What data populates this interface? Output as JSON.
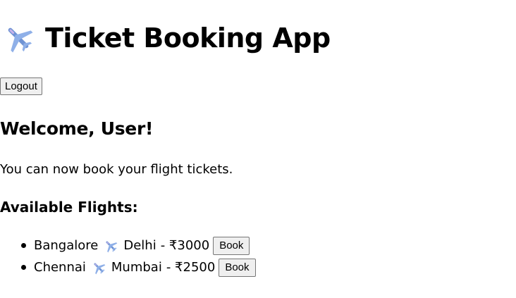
{
  "header": {
    "icon": "airplane-icon",
    "title": "Ticket Booking App"
  },
  "logout_label": "Logout",
  "welcome": "Welcome, User!",
  "subtitle": "You can now book your flight tickets.",
  "flights_heading": "Available Flights:",
  "flights": [
    {
      "from": "Bangalore",
      "to": "Delhi",
      "price": "- ₹3000",
      "book_label": "Book"
    },
    {
      "from": "Chennai",
      "to": "Mumbai",
      "price": "- ₹2500",
      "book_label": "Book"
    }
  ],
  "colors": {
    "button_bg": "#efefef",
    "button_border": "#767676",
    "plane_body": "#6a8fd0",
    "plane_accent": "#b79ad8"
  }
}
